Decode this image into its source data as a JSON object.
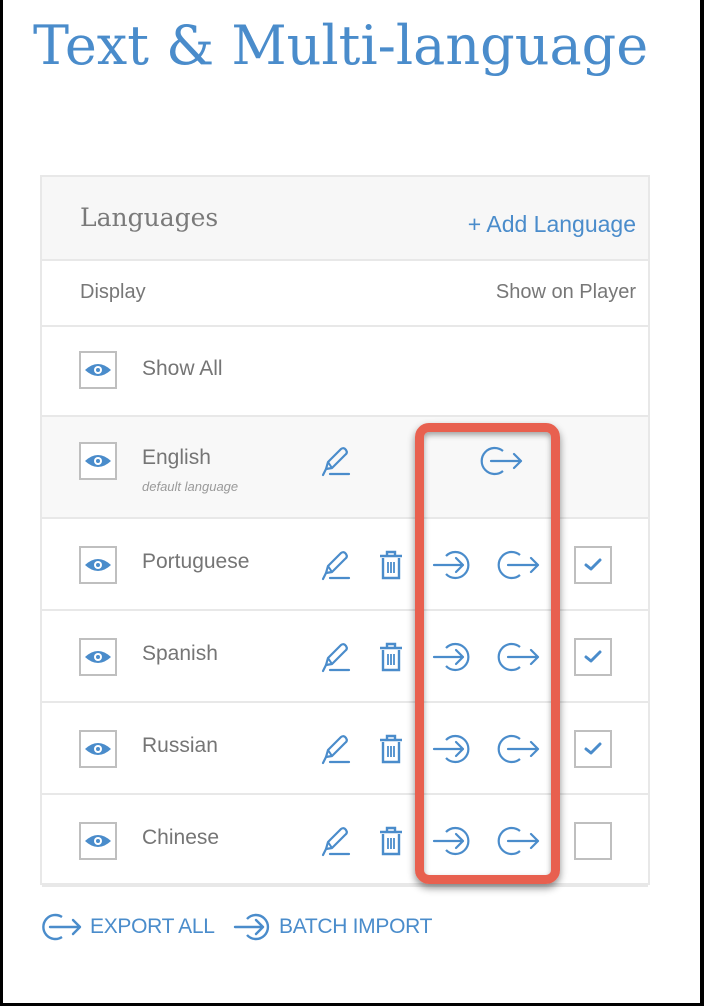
{
  "page": {
    "title": "Text & Multi-language"
  },
  "panel": {
    "title": "Languages",
    "add_language_label": "+ Add Language",
    "columns": {
      "display": "Display",
      "show_on_player": "Show on Player"
    },
    "show_all_label": "Show All",
    "languages": [
      {
        "name": "English",
        "subtitle": "default language",
        "visible": true,
        "actions": [
          "edit",
          "export"
        ],
        "show_on_player": null
      },
      {
        "name": "Portuguese",
        "subtitle": "",
        "visible": true,
        "actions": [
          "edit",
          "delete",
          "import",
          "export"
        ],
        "show_on_player": true
      },
      {
        "name": "Spanish",
        "subtitle": "",
        "visible": true,
        "actions": [
          "edit",
          "delete",
          "import",
          "export"
        ],
        "show_on_player": true
      },
      {
        "name": "Russian",
        "subtitle": "",
        "visible": true,
        "actions": [
          "edit",
          "delete",
          "import",
          "export"
        ],
        "show_on_player": true
      },
      {
        "name": "Chinese",
        "subtitle": "",
        "visible": true,
        "actions": [
          "edit",
          "delete",
          "import",
          "export"
        ],
        "show_on_player": false
      }
    ]
  },
  "footer": {
    "export_all_label": "EXPORT ALL",
    "batch_import_label": "BATCH IMPORT"
  },
  "icons": {
    "eye": "eye-icon",
    "edit": "pencil-icon",
    "delete": "trash-icon",
    "import": "import-icon",
    "export": "export-icon",
    "check": "checkmark-icon"
  },
  "colors": {
    "accent": "#4a8ccb",
    "highlight": "#e8604f",
    "text_muted": "#757575",
    "border": "#e8e8e8"
  }
}
